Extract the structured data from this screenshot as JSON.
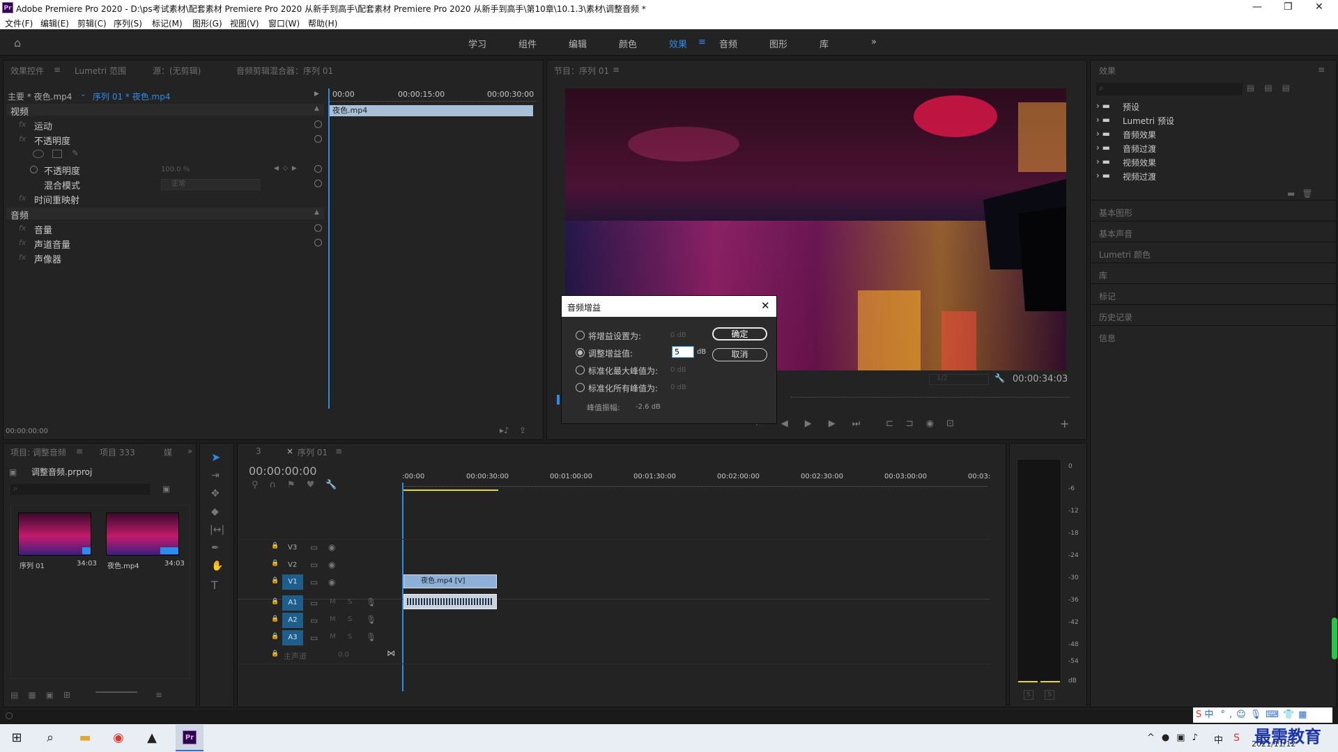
{
  "window": {
    "title": "Adobe Premiere Pro 2020 - D:\\ps考试素材\\配套素材 Premiere Pro 2020 从新手到高手\\配套素材 Premiere Pro 2020 从新手到高手\\第10章\\10.1.3\\素材\\调整音频 *",
    "logo_text": "Pr"
  },
  "menu": [
    "文件(F)",
    "编辑(E)",
    "剪辑(C)",
    "序列(S)",
    "标记(M)",
    "图形(G)",
    "视图(V)",
    "窗口(W)",
    "帮助(H)"
  ],
  "workspaces": [
    "学习",
    "组件",
    "编辑",
    "颜色",
    "效果",
    "音频",
    "图形",
    "库"
  ],
  "active_workspace": "效果",
  "effect_controls": {
    "tabs": [
      "效果控件",
      "Lumetri 范围",
      "源：(无剪辑)",
      "音频剪辑混合器：序列 01"
    ],
    "master": "主要 * 夜色.mp4",
    "sequence": "序列 01 * 夜色.mp4",
    "ruler": [
      "00:00",
      "00:00:15:00",
      "00:00:30:00"
    ],
    "clip": "夜色.mp4",
    "video_header": "视频",
    "rows": [
      "运动",
      "不透明度",
      "不透明度",
      "混合模式",
      "时间重映射"
    ],
    "opacity_value": "100.0 %",
    "blend_value": "正常",
    "audio_header": "音频",
    "audio_rows": [
      "音量",
      "声道音量",
      "声像器"
    ],
    "time": "00:00:00:00",
    "fx": "fx"
  },
  "program": {
    "tab": "节目：序列 01",
    "timecode": "00:00:34:03",
    "fit": "1/2"
  },
  "effects_panel": {
    "title": "效果",
    "folders": [
      "预设",
      "Lumetri 预设",
      "音频效果",
      "音频过渡",
      "视频效果",
      "视频过渡"
    ],
    "collapsed": [
      "基本图形",
      "基本声音",
      "Lumetri 颜色",
      "库",
      "标记",
      "历史记录",
      "信息"
    ]
  },
  "dialog": {
    "title": "音频增益",
    "options": [
      {
        "label": "将增益设置为:",
        "value": "0 dB",
        "selected": false
      },
      {
        "label": "调整增益值:",
        "value": "5",
        "unit": "dB",
        "selected": true
      },
      {
        "label": "标准化最大峰值为:",
        "value": "0 dB",
        "selected": false
      },
      {
        "label": "标准化所有峰值为:",
        "value": "0 dB",
        "selected": false
      }
    ],
    "peak_label": "峰值振幅:",
    "peak_value": "-2.6 dB",
    "ok": "确定",
    "cancel": "取消"
  },
  "project": {
    "tabs": [
      "项目: 调整音频",
      "项目 333"
    ],
    "file": "调整音频.prproj",
    "items": [
      {
        "name": "序列 01",
        "duration": "34:03"
      },
      {
        "name": "夜色.mp4",
        "duration": "34:03"
      }
    ]
  },
  "timeline": {
    "tab_num": "3",
    "tab": "序列 01",
    "timecode": "00:00:00:00",
    "ruler": [
      ":00:00",
      "00:00:30:00",
      "00:01:00:00",
      "00:01:30:00",
      "00:02:00:00",
      "00:02:30:00",
      "00:03:00:00",
      "00:03:"
    ],
    "video_tracks": [
      "V3",
      "V2",
      "V1"
    ],
    "audio_tracks": [
      "A1",
      "A2",
      "A3"
    ],
    "master": "主声道",
    "master_value": "0.0",
    "video_clip": "夜色.mp4 [V]",
    "m": "M",
    "s": "S"
  },
  "meter": {
    "labels": [
      "0",
      "-6",
      "-12",
      "-18",
      "-24",
      "-30",
      "-36",
      "-42",
      "-48",
      "-54",
      "dB"
    ],
    "s_label": "S"
  },
  "taskbar": {
    "date": "2021/11/12",
    "ime": "中",
    "watermark": "最需教育"
  }
}
